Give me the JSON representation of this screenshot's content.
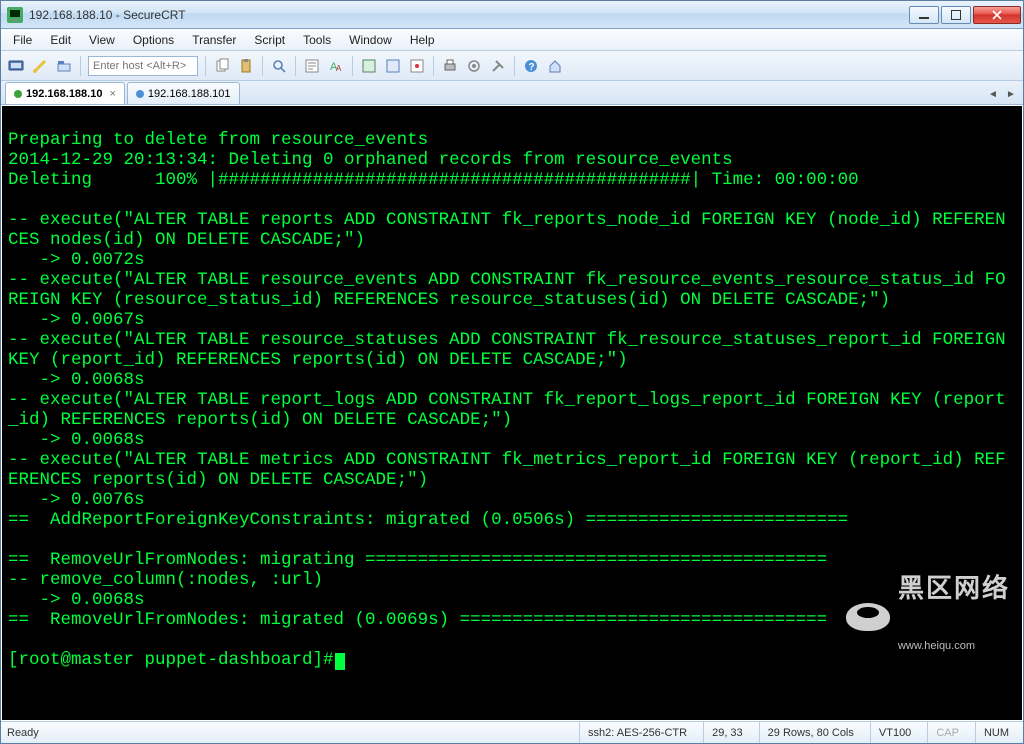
{
  "window": {
    "title": "192.168.188.10 - SecureCRT"
  },
  "menu": {
    "file": "File",
    "edit": "Edit",
    "view": "View",
    "options": "Options",
    "transfer": "Transfer",
    "script": "Script",
    "tools": "Tools",
    "window": "Window",
    "help": "Help"
  },
  "toolbar": {
    "host_placeholder": "Enter host <Alt+R>"
  },
  "tabs": {
    "active": "192.168.188.10",
    "inactive": "192.168.188.101"
  },
  "terminal": {
    "lines": "\nPreparing to delete from resource_events\n2014-12-29 20:13:34: Deleting 0 orphaned records from resource_events\nDeleting      100% |#############################################| Time: 00:00:00\n\n-- execute(\"ALTER TABLE reports ADD CONSTRAINT fk_reports_node_id FOREIGN KEY (node_id) REFERENCES nodes(id) ON DELETE CASCADE;\")\n   -> 0.0072s\n-- execute(\"ALTER TABLE resource_events ADD CONSTRAINT fk_resource_events_resource_status_id FOREIGN KEY (resource_status_id) REFERENCES resource_statuses(id) ON DELETE CASCADE;\")\n   -> 0.0067s\n-- execute(\"ALTER TABLE resource_statuses ADD CONSTRAINT fk_resource_statuses_report_id FOREIGN KEY (report_id) REFERENCES reports(id) ON DELETE CASCADE;\")\n   -> 0.0068s\n-- execute(\"ALTER TABLE report_logs ADD CONSTRAINT fk_report_logs_report_id FOREIGN KEY (report_id) REFERENCES reports(id) ON DELETE CASCADE;\")\n   -> 0.0068s\n-- execute(\"ALTER TABLE metrics ADD CONSTRAINT fk_metrics_report_id FOREIGN KEY (report_id) REFERENCES reports(id) ON DELETE CASCADE;\")\n   -> 0.0076s\n==  AddReportForeignKeyConstraints: migrated (0.0506s) =========================\n\n==  RemoveUrlFromNodes: migrating ============================================\n-- remove_column(:nodes, :url)\n   -> 0.0068s\n==  RemoveUrlFromNodes: migrated (0.0069s) ===================================\n",
    "prompt": "[root@master puppet-dashboard]#"
  },
  "status": {
    "ready": "Ready",
    "conn": "ssh2: AES-256-CTR",
    "cursor": "29, 33",
    "size": "29 Rows, 80 Cols",
    "term": "VT100",
    "caps": "CAP",
    "num": "NUM"
  },
  "watermark": {
    "big": "黑区网络",
    "small": "www.heiqu.com"
  }
}
